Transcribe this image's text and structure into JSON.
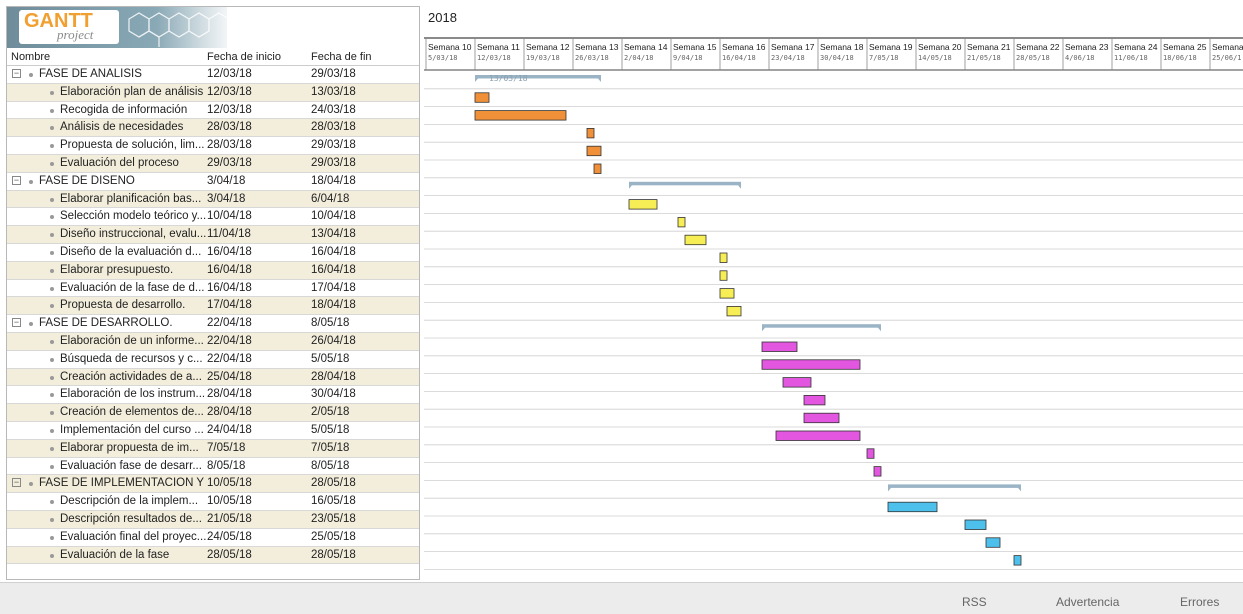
{
  "app": {
    "logo_main": "GANTT",
    "logo_sub": "project"
  },
  "table": {
    "headers": {
      "name": "Nombre",
      "start": "Fecha de inicio",
      "end": "Fecha de fin"
    },
    "rows": [
      {
        "name": "FASE DE ANÁLISIS",
        "start": "12/03/18",
        "end": "29/03/18",
        "group": true
      },
      {
        "name": "Elaboración plan de análisis",
        "start": "12/03/18",
        "end": "13/03/18"
      },
      {
        "name": "Recogida de información",
        "start": "12/03/18",
        "end": "24/03/18"
      },
      {
        "name": "Análisis de necesidades",
        "start": "28/03/18",
        "end": "28/03/18"
      },
      {
        "name": "Propuesta de solución, lim...",
        "start": "28/03/18",
        "end": "29/03/18"
      },
      {
        "name": "Evaluación del proceso",
        "start": "29/03/18",
        "end": "29/03/18"
      },
      {
        "name": "FASE DE DISEÑO",
        "start": "3/04/18",
        "end": "18/04/18",
        "group": true
      },
      {
        "name": "Elaborar planificación bas...",
        "start": "3/04/18",
        "end": "6/04/18"
      },
      {
        "name": "Selección modelo teórico y...",
        "start": "10/04/18",
        "end": "10/04/18"
      },
      {
        "name": "Diseño instruccional, evalu...",
        "start": "11/04/18",
        "end": "13/04/18"
      },
      {
        "name": "Diseño de la evaluación d...",
        "start": "16/04/18",
        "end": "16/04/18"
      },
      {
        "name": "Elaborar presupuesto.",
        "start": "16/04/18",
        "end": "16/04/18"
      },
      {
        "name": "Evaluación de la fase de d...",
        "start": "16/04/18",
        "end": "17/04/18"
      },
      {
        "name": "Propuesta de desarrollo.",
        "start": "17/04/18",
        "end": "18/04/18"
      },
      {
        "name": "FASE DE DESARROLLO.",
        "start": "22/04/18",
        "end": "8/05/18",
        "group": true
      },
      {
        "name": "Elaboración de un informe...",
        "start": "22/04/18",
        "end": "26/04/18"
      },
      {
        "name": "Búsqueda de recursos y c...",
        "start": "22/04/18",
        "end": "5/05/18"
      },
      {
        "name": "Creación actividades de a...",
        "start": "25/04/18",
        "end": "28/04/18"
      },
      {
        "name": "Elaboración de los instrum...",
        "start": "28/04/18",
        "end": "30/04/18"
      },
      {
        "name": "Creación de elementos de...",
        "start": "28/04/18",
        "end": "2/05/18"
      },
      {
        "name": "Implementación del curso ...",
        "start": "24/04/18",
        "end": "5/05/18"
      },
      {
        "name": "Elaborar propuesta de im...",
        "start": "7/05/18",
        "end": "7/05/18"
      },
      {
        "name": "Evaluación fase de desarr...",
        "start": "8/05/18",
        "end": "8/05/18"
      },
      {
        "name": "FASE DE IMPLEMENTACIÓN Y ...",
        "start": "10/05/18",
        "end": "28/05/18",
        "group": true
      },
      {
        "name": "Descripción de la implem...",
        "start": "10/05/18",
        "end": "16/05/18"
      },
      {
        "name": "Descripción resultados de...",
        "start": "21/05/18",
        "end": "23/05/18"
      },
      {
        "name": "Evaluación final del proyec...",
        "start": "24/05/18",
        "end": "25/05/18"
      },
      {
        "name": "Evaluación de la fase",
        "start": "28/05/18",
        "end": "28/05/18"
      }
    ]
  },
  "timeline": {
    "year": "2018",
    "week_prefix": "Semana",
    "weeks": [
      {
        "label": "Semana 10",
        "date": "5/03/18"
      },
      {
        "label": "Semana 11",
        "date": "12/03/18"
      },
      {
        "label": "Semana 12",
        "date": "19/03/18"
      },
      {
        "label": "Semana 13",
        "date": "26/03/18"
      },
      {
        "label": "Semana 14",
        "date": "2/04/18"
      },
      {
        "label": "Semana 15",
        "date": "9/04/18"
      },
      {
        "label": "Semana 16",
        "date": "16/04/18"
      },
      {
        "label": "Semana 17",
        "date": "23/04/18"
      },
      {
        "label": "Semana 18",
        "date": "30/04/18"
      },
      {
        "label": "Semana 19",
        "date": "7/05/18"
      },
      {
        "label": "Semana 20",
        "date": "14/05/18"
      },
      {
        "label": "Semana 21",
        "date": "21/05/18"
      },
      {
        "label": "Semana 22",
        "date": "28/05/18"
      },
      {
        "label": "Semana 23",
        "date": "4/06/18"
      },
      {
        "label": "Semana 24",
        "date": "11/06/18"
      },
      {
        "label": "Semana 25",
        "date": "18/06/18"
      },
      {
        "label": "Semana",
        "date": "25/06/1"
      }
    ],
    "today_marker": "13/03/18",
    "colors": {
      "analisis": "#f0913a",
      "diseno": "#f7ee55",
      "desarrollo": "#e356e0",
      "implementacion": "#4dc0ec",
      "summary": "#9ab4c6"
    }
  },
  "statusbar": {
    "rss": "RSS",
    "warning": "Advertencia",
    "errors": "Errores"
  }
}
